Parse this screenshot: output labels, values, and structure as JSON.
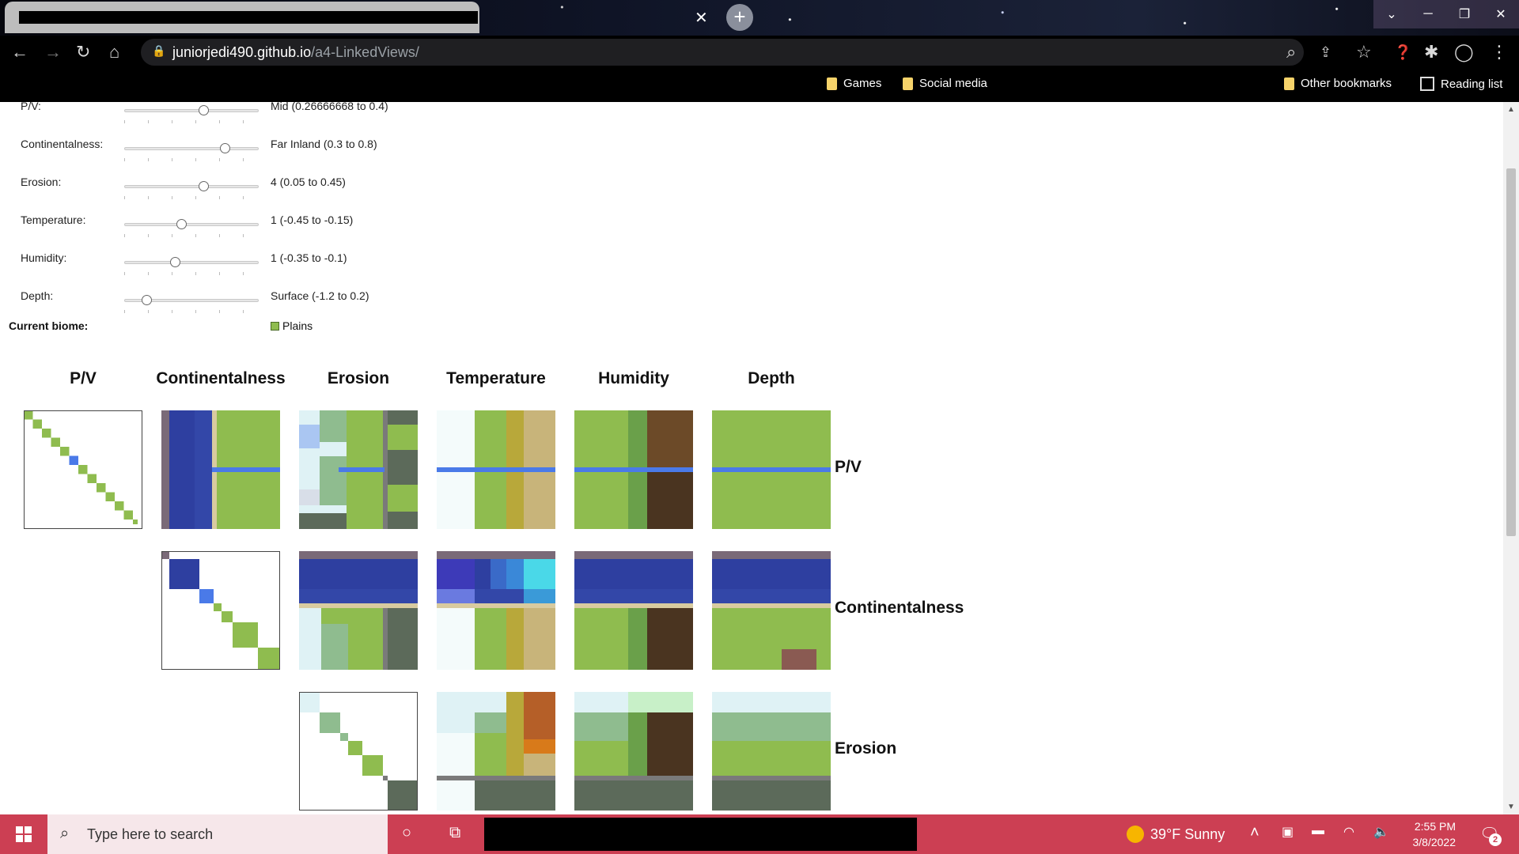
{
  "browser": {
    "url_domain": "juniorjedi490.github.io",
    "url_path": "/a4-LinkedViews/",
    "bookmarks": [
      "Games",
      "Social media"
    ],
    "other_bookmarks": "Other bookmarks",
    "reading_list": "Reading list"
  },
  "controls": [
    {
      "label": "P/V:",
      "value_text": "Mid (0.26666668 to 0.4)",
      "position": 0.6
    },
    {
      "label": "Continentalness:",
      "value_text": "Far Inland (0.3 to 0.8)",
      "position": 0.77
    },
    {
      "label": "Erosion:",
      "value_text": "4 (0.05 to 0.45)",
      "position": 0.6
    },
    {
      "label": "Temperature:",
      "value_text": "1 (-0.45 to -0.15)",
      "position": 0.42
    },
    {
      "label": "Humidity:",
      "value_text": "1 (-0.35 to -0.1)",
      "position": 0.37
    },
    {
      "label": "Depth:",
      "value_text": "Surface (-1.2 to 0.2)",
      "position": 0.14
    }
  ],
  "current_biome": {
    "label": "Current biome:",
    "value": "Plains",
    "color": "#8fbc4f"
  },
  "columns": [
    "P/V",
    "Continentalness",
    "Erosion",
    "Temperature",
    "Humidity",
    "Depth"
  ],
  "rows": [
    "P/V",
    "Continentalness",
    "Erosion"
  ],
  "palette": {
    "plains": "#8fbc4f",
    "ocean": "#3347a8",
    "deep_ocean": "#2e3fa0",
    "river": "#4a7ae8",
    "beach": "#d8cba0",
    "stony": "#5c6a5a",
    "ice": "#dff2f5",
    "snowy": "#f4fbfb",
    "badlands": "#c8b47a",
    "savanna": "#b8a83a",
    "dark_forest": "#4a3420",
    "forest": "#6aa04a",
    "birch": "#6c4a28",
    "jungle": "#b55f28",
    "mushroom": "#8a5a52",
    "frozen_ocean": "#3d3ab8",
    "warm_ocean": "#4ad8e8",
    "meadow": "#8fbc8f",
    "cherry": "#c8f0c8"
  },
  "taskbar": {
    "search_placeholder": "Type here to search",
    "weather": "39°F  Sunny",
    "time": "2:55 PM",
    "date": "3/8/2022",
    "notifications": "2"
  }
}
